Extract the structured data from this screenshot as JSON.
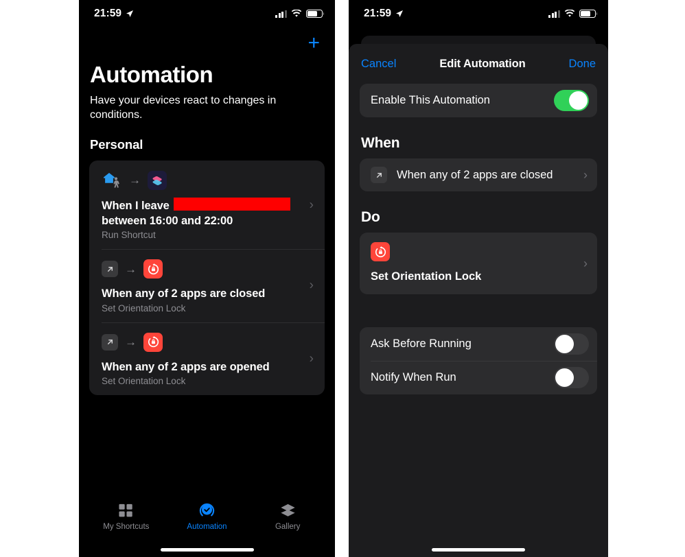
{
  "colors": {
    "accent_blue": "#0a84ff",
    "switch_on_green": "#30d158",
    "redaction_red": "#fe0000",
    "orientation_icon_red": "#ff453a",
    "card_bg": "#1c1c1e",
    "group_bg": "#2c2c2e",
    "secondary_text": "#8e8e93",
    "screen_bg": "#000000",
    "page_bg": "#ffffff"
  },
  "left_screen": {
    "status_bar": {
      "time": "21:59",
      "location_icon": "location-arrow-icon",
      "signal_icon": "cellular-signal-icon",
      "signal_bars_filled": 3,
      "signal_bars_total": 4,
      "wifi_icon": "wifi-icon",
      "battery_icon": "battery-icon",
      "battery_level_percent": 64
    },
    "add_button": {
      "label": "+",
      "icon": "plus-icon"
    },
    "title": "Automation",
    "subtitle": "Have your devices react to changes in conditions.",
    "section_header": "Personal",
    "automations": [
      {
        "trigger_icon": "home-leave-icon",
        "arrow_icon": "arrow-right-icon",
        "action_icon": "shortcuts-app-icon",
        "title_prefix": "When I leave ",
        "title_redacted": true,
        "title_suffix": "between 16:00 and 22:00",
        "subtitle": "Run Shortcut",
        "chevron_icon": "chevron-right-icon"
      },
      {
        "trigger_icon": "app-open-icon",
        "arrow_icon": "arrow-right-icon",
        "action_icon": "orientation-lock-icon",
        "title_prefix": "When any of 2 apps are closed",
        "title_redacted": false,
        "title_suffix": "",
        "subtitle": "Set Orientation Lock",
        "chevron_icon": "chevron-right-icon"
      },
      {
        "trigger_icon": "app-open-icon",
        "arrow_icon": "arrow-right-icon",
        "action_icon": "orientation-lock-icon",
        "title_prefix": "When any of 2 apps are opened",
        "title_redacted": false,
        "title_suffix": "",
        "subtitle": "Set Orientation Lock",
        "chevron_icon": "chevron-right-icon"
      }
    ],
    "tab_bar": [
      {
        "label": "My Shortcuts",
        "icon": "grid-squares-icon",
        "active": false
      },
      {
        "label": "Automation",
        "icon": "clock-check-icon",
        "active": true
      },
      {
        "label": "Gallery",
        "icon": "layers-icon",
        "active": false
      }
    ]
  },
  "right_screen": {
    "status_bar": {
      "time": "21:59",
      "location_icon": "location-arrow-icon",
      "signal_icon": "cellular-signal-icon",
      "signal_bars_filled": 3,
      "signal_bars_total": 4,
      "wifi_icon": "wifi-icon",
      "battery_icon": "battery-icon",
      "battery_level_percent": 64
    },
    "nav": {
      "cancel_label": "Cancel",
      "title": "Edit Automation",
      "done_label": "Done"
    },
    "enable_row": {
      "label": "Enable This Automation",
      "toggle_state": "on"
    },
    "when_section": {
      "header": "When",
      "trigger_icon": "app-open-icon",
      "trigger_label": "When any of 2 apps are closed",
      "chevron_icon": "chevron-right-icon"
    },
    "do_section": {
      "header": "Do",
      "action_icon": "orientation-lock-icon",
      "action_label": "Set Orientation Lock",
      "chevron_icon": "chevron-right-icon"
    },
    "options": [
      {
        "label": "Ask Before Running",
        "toggle_state": "off"
      },
      {
        "label": "Notify When Run",
        "toggle_state": "off"
      }
    ]
  }
}
